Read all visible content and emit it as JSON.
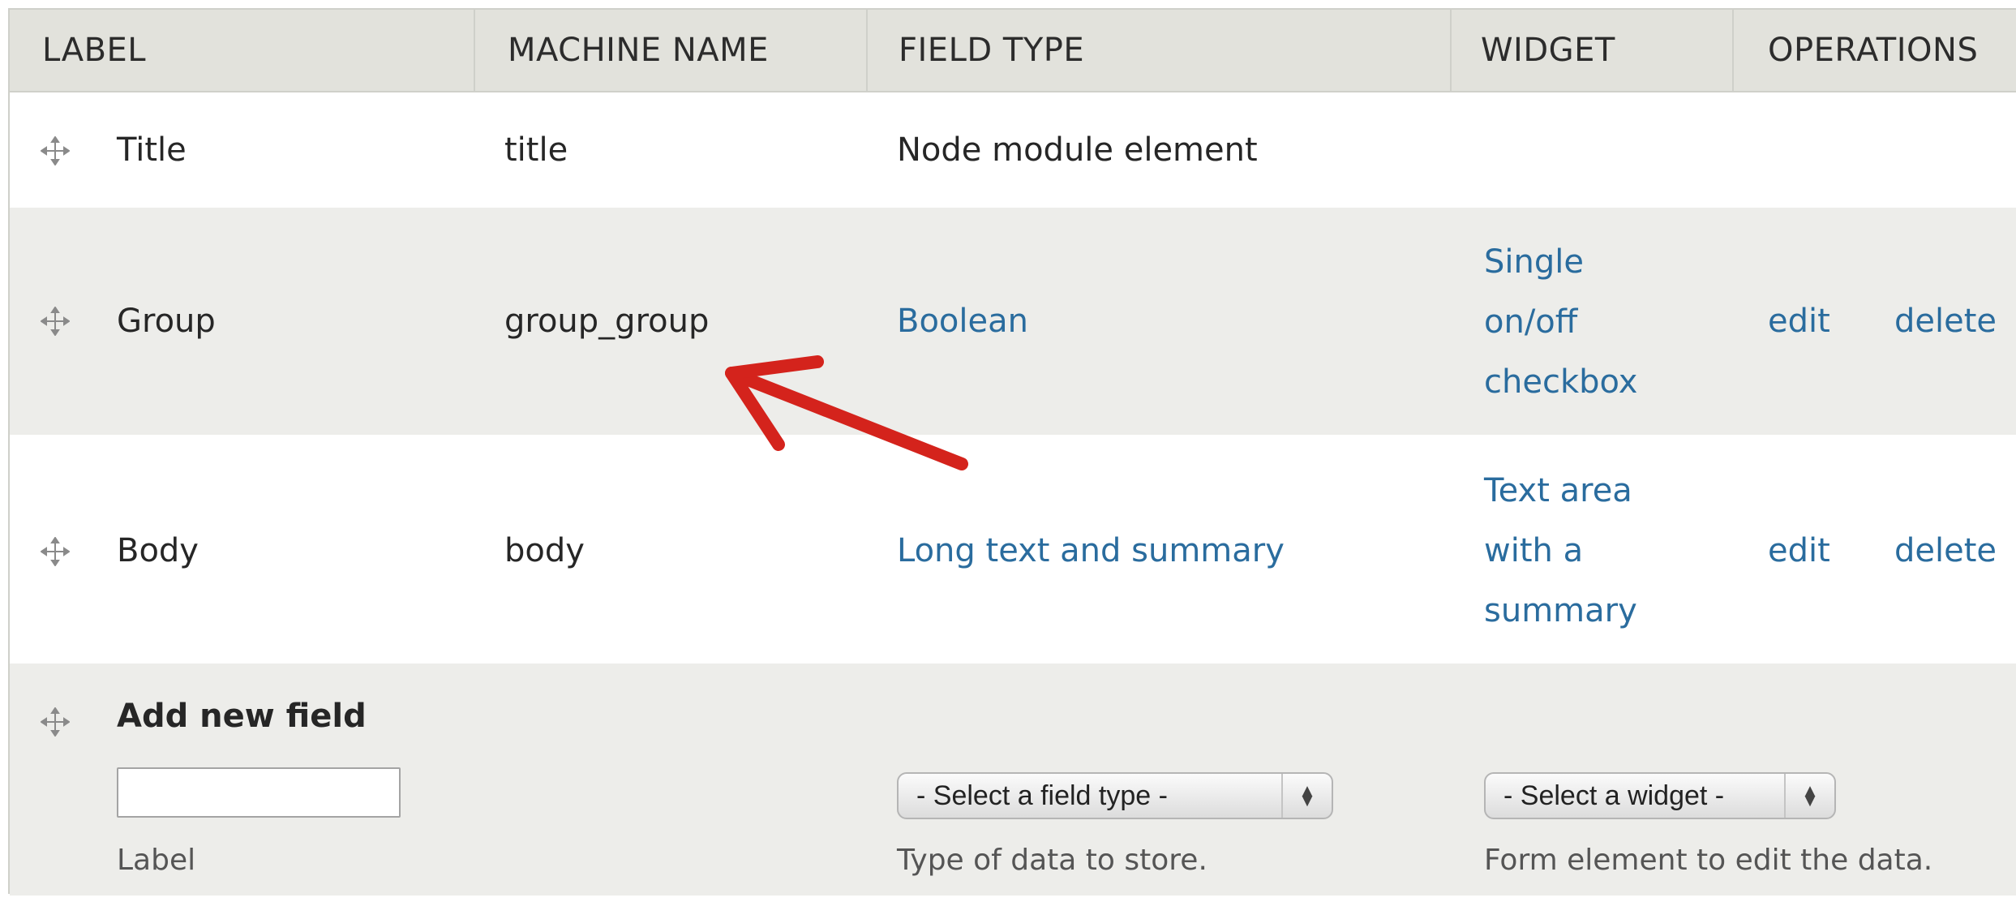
{
  "header": {
    "label": "LABEL",
    "machine_name": "MACHINE NAME",
    "field_type": "FIELD TYPE",
    "widget": "WIDGET",
    "operations": "OPERATIONS"
  },
  "rows": [
    {
      "label": "Title",
      "machine_name": "title",
      "field_type": "Node module element"
    },
    {
      "label": "Group",
      "machine_name": "group_group",
      "field_type": "Boolean",
      "widget": [
        "Single",
        "on/off",
        "checkbox"
      ],
      "edit": "edit",
      "delete": "delete"
    },
    {
      "label": "Body",
      "machine_name": "body",
      "field_type": "Long text and summary",
      "widget": [
        "Text area",
        "with a",
        "summary"
      ],
      "edit": "edit",
      "delete": "delete"
    }
  ],
  "add_new": {
    "title": "Add new field",
    "label_input_value": "",
    "label_hint": "Label",
    "field_type_select": "- Select a field type -",
    "field_type_hint": "Type of data to store.",
    "widget_select": "- Select a widget -",
    "widget_hint": "Form element to edit the data."
  },
  "colors": {
    "link": "#2a6c9e",
    "header_bg": "#e2e2dc",
    "even_row_bg": "#ededea",
    "annotation_arrow": "#d4231c"
  },
  "icons": [
    "drag-handle-icon",
    "select-arrows-icon",
    "annotation-arrow"
  ]
}
